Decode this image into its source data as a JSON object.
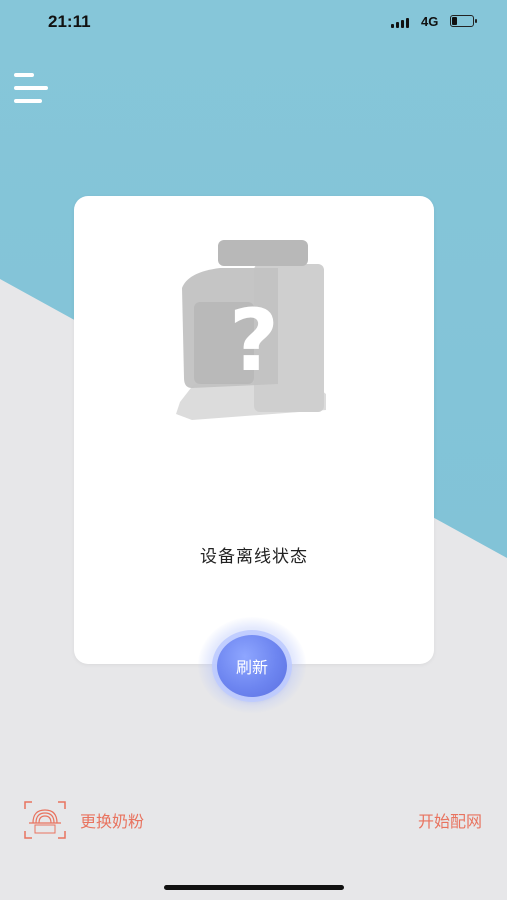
{
  "status_bar": {
    "time": "21:11",
    "network": "4G"
  },
  "device": {
    "status": "设备离线状态",
    "refresh_label": "刷新"
  },
  "footer": {
    "change_formula_label": "更换奶粉",
    "start_pairing_label": "开始配网"
  },
  "colors": {
    "accent_blue": "#86c6d9",
    "refresh_button": "#6d85f0",
    "action_text": "#e8735f"
  }
}
